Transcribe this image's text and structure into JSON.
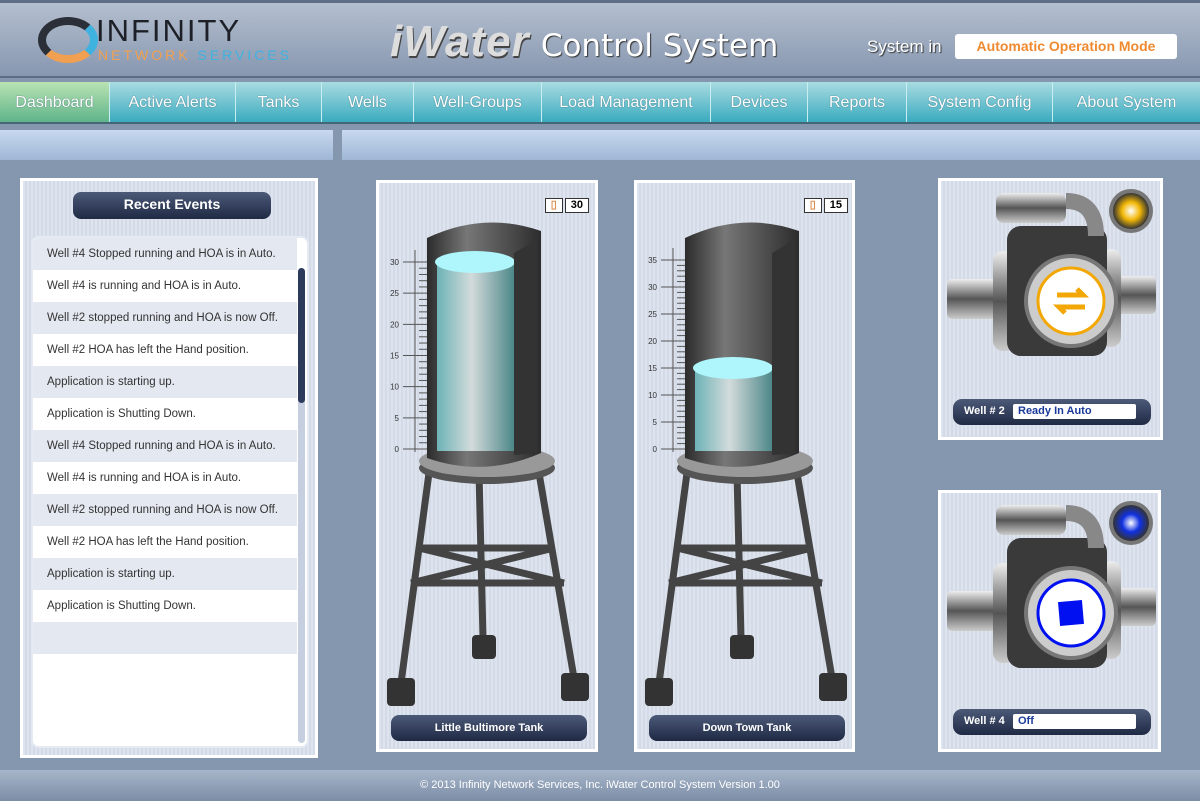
{
  "header": {
    "logo_line1": "INFINITY",
    "logo_line2a": "NETWORK",
    "logo_line2b": "SERVICES",
    "title_brand": "iWater",
    "title_rest": "Control System",
    "mode_label": "System in",
    "mode_value": "Automatic Operation Mode"
  },
  "nav": [
    "Dashboard",
    "Active Alerts",
    "Tanks",
    "Wells",
    "Well-Groups",
    "Load Management",
    "Devices",
    "Reports",
    "System Config",
    "About System"
  ],
  "events": {
    "title": "Recent Events",
    "items": [
      "Well #4 Stopped running and HOA is in Auto.",
      "Well #4 is running and HOA is in Auto.",
      "Well #2 stopped running and HOA is now Off.",
      "Well #2 HOA has left the Hand position.",
      "Application is starting up.",
      "Application is Shutting Down.",
      "Well #4 Stopped running and HOA is in Auto.",
      "Well #4 is running and HOA is in Auto.",
      "Well #2 stopped running and HOA is now Off.",
      "Well #2 HOA has left the Hand position.",
      "Application is starting up.",
      "Application is Shutting Down.",
      "",
      ""
    ]
  },
  "tanks": [
    {
      "name": "Little Bultimore Tank",
      "level": 30,
      "level_label": "30",
      "scale_max": 30,
      "ticks": [
        "0",
        "5",
        "10",
        "15",
        "20",
        "25",
        "30"
      ]
    },
    {
      "name": "Down Town Tank",
      "level": 15,
      "level_label": "15",
      "scale_max": 35,
      "ticks": [
        "0",
        "5",
        "10",
        "15",
        "20",
        "25",
        "30",
        "35"
      ]
    }
  ],
  "wells": [
    {
      "label": "Well # 2",
      "status": "Ready In Auto",
      "light_color": "#f2b705",
      "icon": "arrows-swap-icon",
      "icon_color": "#f2a705"
    },
    {
      "label": "Well # 4",
      "status": "Off",
      "light_color": "#1030e0",
      "icon": "stop-square-icon",
      "icon_color": "#0010f0"
    }
  ],
  "footer": "© 2013 Infinity Network Services, Inc.   iWater Control System Version 1.00"
}
